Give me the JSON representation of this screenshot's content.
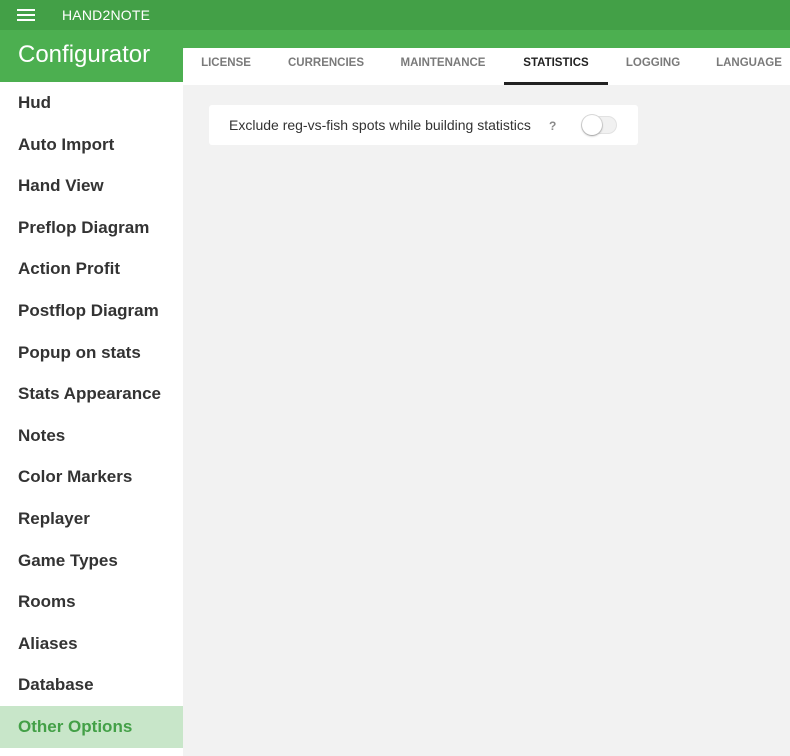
{
  "app": {
    "title": "HAND2NOTE"
  },
  "sidebar": {
    "title": "Configurator",
    "items": [
      {
        "label": "Hud",
        "active": false
      },
      {
        "label": "Auto Import",
        "active": false
      },
      {
        "label": "Hand View",
        "active": false
      },
      {
        "label": "Preflop Diagram",
        "active": false
      },
      {
        "label": "Action Profit",
        "active": false
      },
      {
        "label": "Postflop Diagram",
        "active": false
      },
      {
        "label": "Popup on stats",
        "active": false
      },
      {
        "label": "Stats Appearance",
        "active": false
      },
      {
        "label": "Notes",
        "active": false
      },
      {
        "label": "Color Markers",
        "active": false
      },
      {
        "label": "Replayer",
        "active": false
      },
      {
        "label": "Game Types",
        "active": false
      },
      {
        "label": "Rooms",
        "active": false
      },
      {
        "label": "Aliases",
        "active": false
      },
      {
        "label": "Database",
        "active": false
      },
      {
        "label": "Other Options",
        "active": true
      }
    ]
  },
  "tabs": [
    {
      "label": "LICENSE",
      "active": false
    },
    {
      "label": "CURRENCIES",
      "active": false
    },
    {
      "label": "MAINTENANCE",
      "active": false
    },
    {
      "label": "STATISTICS",
      "active": true
    },
    {
      "label": "LOGGING",
      "active": false
    },
    {
      "label": "LANGUAGE",
      "active": false
    }
  ],
  "statistics": {
    "exclude_option": {
      "label": "Exclude reg-vs-fish spots while building statistics",
      "help": "?",
      "enabled": false
    }
  },
  "colors": {
    "accent": "#4caf50",
    "topbar": "#43a047",
    "active_item_bg": "#c8e6c9",
    "background": "#f2f2f2"
  }
}
